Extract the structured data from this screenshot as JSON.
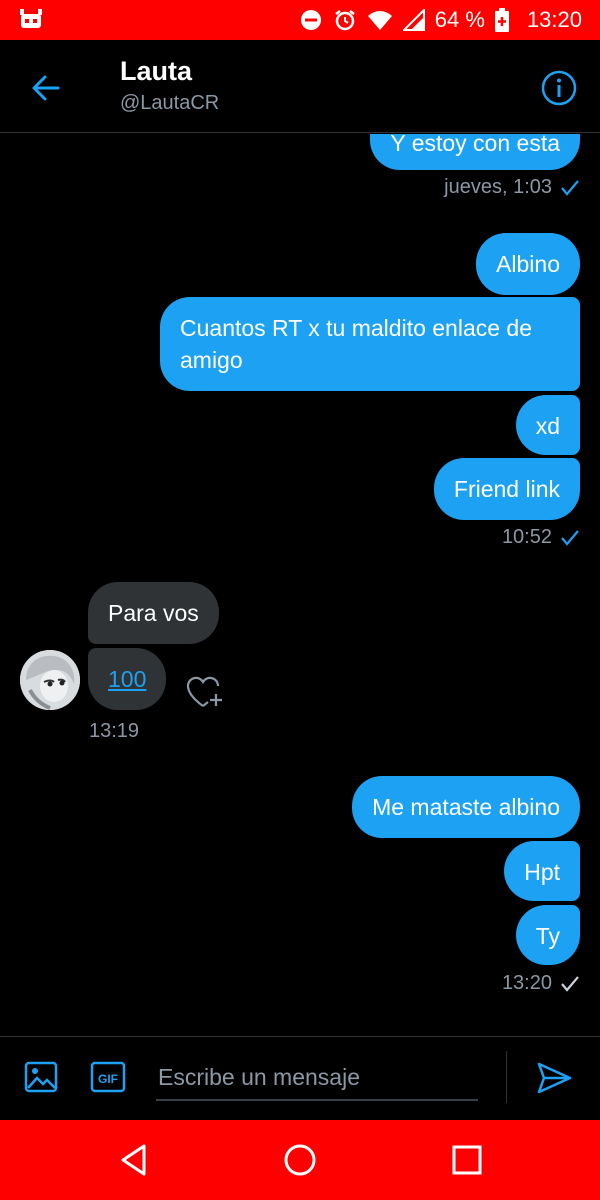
{
  "status_bar": {
    "battery": "64 %",
    "time": "13:20"
  },
  "header": {
    "name": "Lauta",
    "handle": "@LautaCR"
  },
  "messages": {
    "m1": "Y estoy con esta",
    "m1_meta": "jueves, 1:03",
    "m2": "Albino",
    "m3": "Cuantos RT x tu maldito enlace de amigo",
    "m4": "xd",
    "m5": "Friend link",
    "m5_meta": "10:52",
    "in1": "Para vos",
    "in2": "100",
    "in_meta": "13:19",
    "m6": "Me mataste albino",
    "m7": "Hpt",
    "m8": "Ty",
    "m8_meta": "13:20"
  },
  "composer": {
    "placeholder": "Escribe un mensaje"
  },
  "colors": {
    "accent": "#1da1f2",
    "system_bar": "#ff0000",
    "incoming_bubble": "#2f3336",
    "muted_text": "#8b98a5"
  }
}
